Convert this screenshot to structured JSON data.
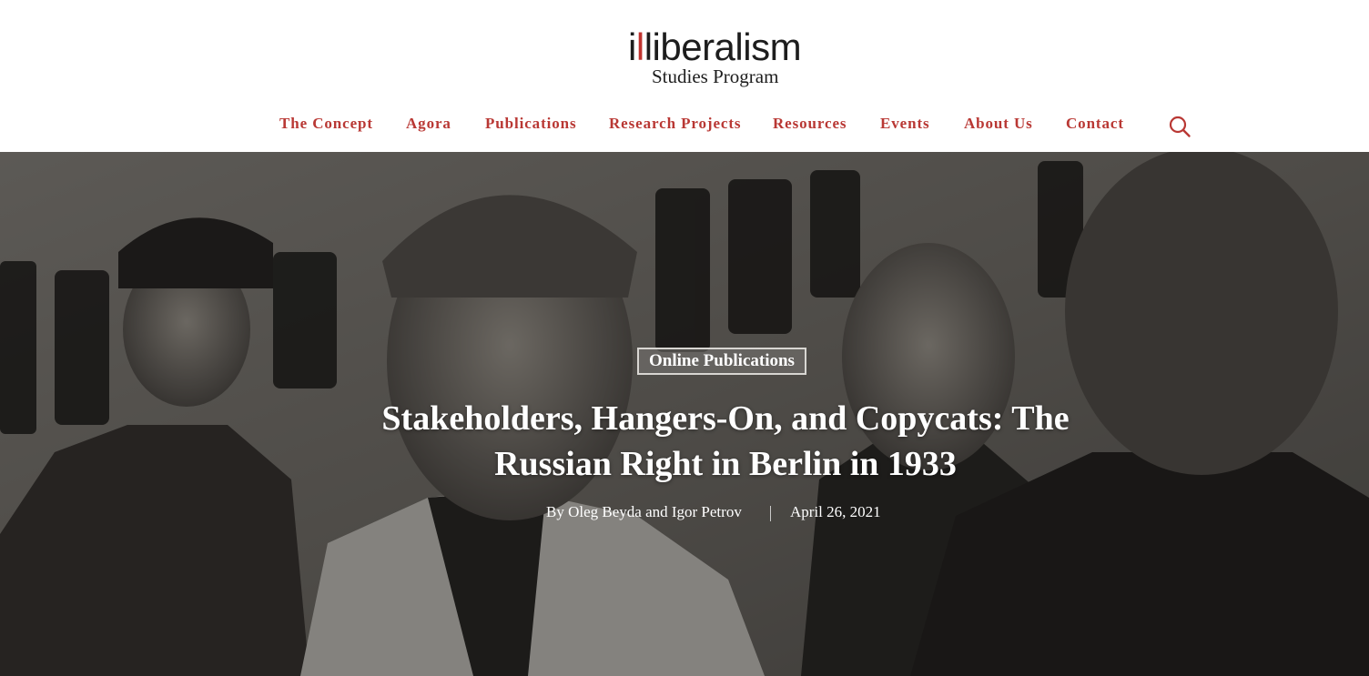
{
  "brand": {
    "logo_prefix": "i",
    "logo_mark": "l",
    "logo_suffix": "liberalism",
    "logo_subtitle": "Studies Program",
    "accent_color": "#b93834"
  },
  "nav": {
    "items": [
      {
        "label": "The Concept"
      },
      {
        "label": "Agora"
      },
      {
        "label": "Publications"
      },
      {
        "label": "Research Projects"
      },
      {
        "label": "Resources"
      },
      {
        "label": "Events"
      },
      {
        "label": "About Us"
      },
      {
        "label": "Contact"
      }
    ],
    "search_icon": "search-icon"
  },
  "hero": {
    "category": "Online Publications",
    "title": "Stakeholders, Hangers-On, and Copycats: The Russian Right in Berlin in 1933",
    "author": "By Oleg Beyda and Igor Petrov",
    "date": "April 26, 2021"
  }
}
